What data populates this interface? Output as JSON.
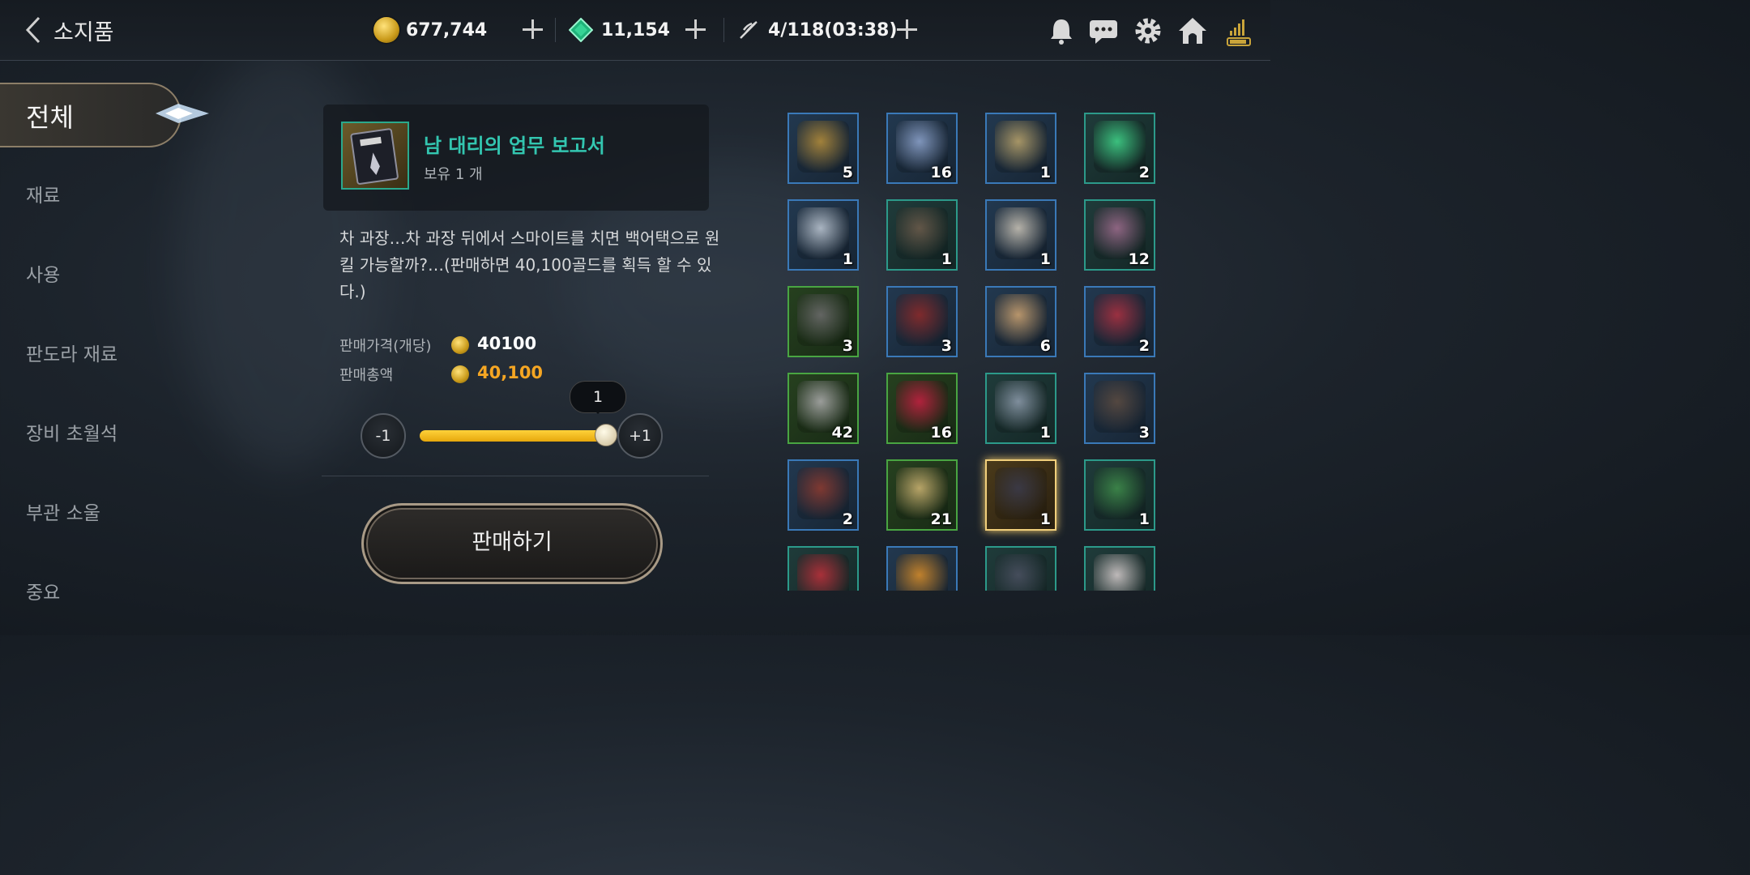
{
  "header": {
    "title": "소지품",
    "gold": "677,744",
    "gems": "11,154",
    "stamina": "4/118(03:38)"
  },
  "sidebar": {
    "items": [
      {
        "label": "전체",
        "active": true
      },
      {
        "label": "재료"
      },
      {
        "label": "사용"
      },
      {
        "label": "판도라 재료"
      },
      {
        "label": "장비 초월석"
      },
      {
        "label": "부관 소울"
      },
      {
        "label": "중요"
      }
    ]
  },
  "detail": {
    "name": "남 대리의 업무 보고서",
    "owned": "보유 1 개",
    "description": "차 과장…차 과장 뒤에서 스마이트를 치면 백어택으로 원 킬 가능할까?…(판매하면 40,100골드를 획득 할 수 있다.)",
    "unit_price_label": "판매가격(개당)",
    "unit_price": "40100",
    "total_label": "판매총액",
    "total": "40,100",
    "quantity": "1",
    "minus_label": "-1",
    "plus_label": "+1",
    "slider_fraction": 1.0,
    "sell_label": "판매하기"
  },
  "inventory": [
    {
      "qty": "5",
      "frame": "blue",
      "icon": "gold-chest-icon"
    },
    {
      "qty": "16",
      "frame": "blue",
      "icon": "blue-gold-chest-icon"
    },
    {
      "qty": "1",
      "frame": "blue",
      "icon": "gold-ring-icon"
    },
    {
      "qty": "2",
      "frame": "teal",
      "icon": "green-feather-icon"
    },
    {
      "qty": "1",
      "frame": "blue",
      "icon": "silver-ring-icon"
    },
    {
      "qty": "1",
      "frame": "teal",
      "icon": "leather-ring-icon"
    },
    {
      "qty": "1",
      "frame": "blue",
      "icon": "pouch-icon"
    },
    {
      "qty": "12",
      "frame": "teal",
      "icon": "hourglass-icon"
    },
    {
      "qty": "3",
      "frame": "green",
      "icon": "dark-claw-icon"
    },
    {
      "qty": "3",
      "frame": "blue",
      "icon": "red-book-icon"
    },
    {
      "qty": "6",
      "frame": "blue",
      "icon": "rune-necklace-icon"
    },
    {
      "qty": "2",
      "frame": "blue",
      "icon": "red-horn-icon"
    },
    {
      "qty": "42",
      "frame": "green",
      "icon": "bone-icon"
    },
    {
      "qty": "16",
      "frame": "green",
      "icon": "red-scale-icon"
    },
    {
      "qty": "1",
      "frame": "teal",
      "icon": "silver-gauntlet-icon"
    },
    {
      "qty": "3",
      "frame": "blue",
      "icon": "stone-mask-icon"
    },
    {
      "qty": "2",
      "frame": "blue",
      "icon": "red-bracelet-icon"
    },
    {
      "qty": "21",
      "frame": "green",
      "icon": "ore-cluster-icon"
    },
    {
      "qty": "1",
      "frame": "gold",
      "icon": "report-book-icon"
    },
    {
      "qty": "1",
      "frame": "teal",
      "icon": "green-book-icon"
    },
    {
      "qty": "",
      "frame": "teal",
      "icon": "red-card-icon"
    },
    {
      "qty": "",
      "frame": "blue",
      "icon": "lantern-icon"
    },
    {
      "qty": "",
      "frame": "teal",
      "icon": "dark-portrait-icon"
    },
    {
      "qty": "",
      "frame": "teal",
      "icon": "light-portrait-icon"
    }
  ],
  "colors": {
    "item_name": "#33c6b0",
    "total_price": "#f5a623",
    "slider": "#ffc81f"
  }
}
